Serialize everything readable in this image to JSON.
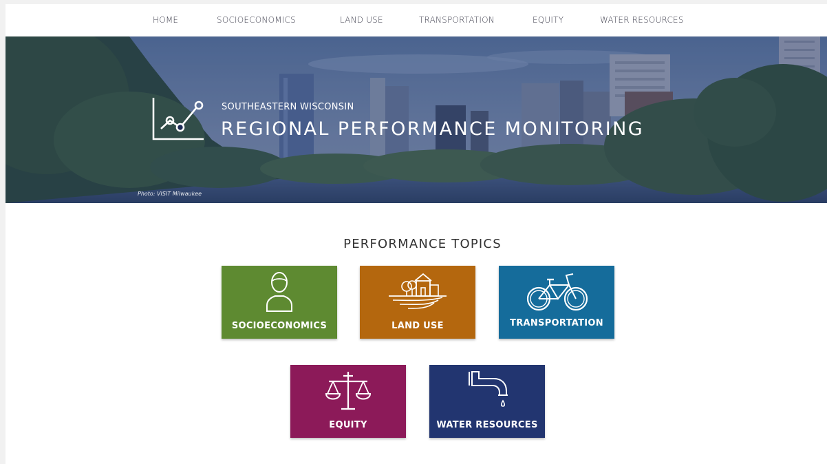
{
  "nav": {
    "items": [
      {
        "label": "HOME"
      },
      {
        "label": "SOCIOECONOMICS"
      },
      {
        "label": "LAND USE"
      },
      {
        "label": "TRANSPORTATION"
      },
      {
        "label": "EQUITY"
      },
      {
        "label": "WATER RESOURCES"
      }
    ]
  },
  "hero": {
    "subtitle": "SOUTHEASTERN WISCONSIN",
    "title": "REGIONAL PERFORMANCE MONITORING",
    "photo_credit": "Photo: VISIT Milwaukee",
    "icon": "line-chart-icon"
  },
  "topics": {
    "heading": "PERFORMANCE TOPICS",
    "tiles": [
      {
        "label": "SOCIOECONOMICS",
        "icon": "person-icon",
        "color": "#5e8a31"
      },
      {
        "label": "LAND USE",
        "icon": "farmhouse-icon",
        "color": "#b4670e"
      },
      {
        "label": "TRANSPORTATION",
        "icon": "bicycle-icon",
        "color": "#156c9b"
      },
      {
        "label": "EQUITY",
        "icon": "scales-icon",
        "color": "#8c1a59"
      },
      {
        "label": "WATER RESOURCES",
        "icon": "faucet-icon",
        "color": "#223570"
      }
    ]
  }
}
